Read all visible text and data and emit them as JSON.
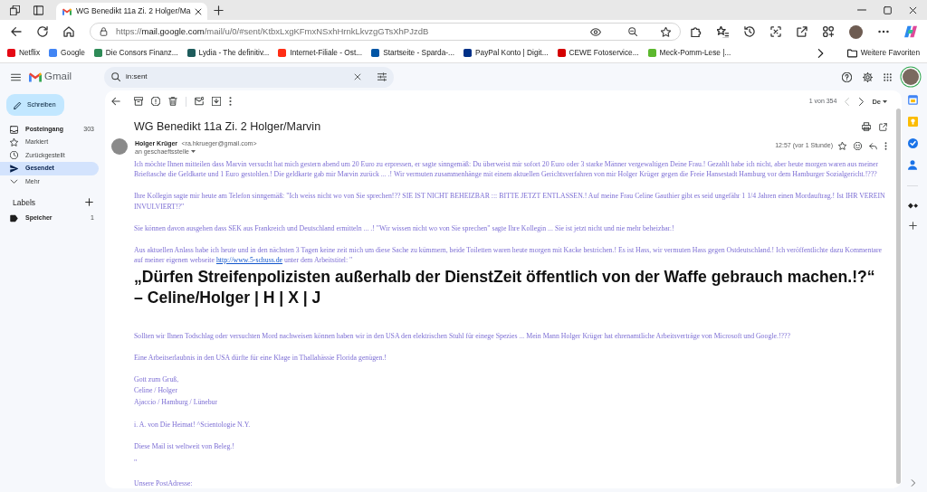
{
  "browser": {
    "tab": {
      "title": "WG Benedikt 11a Zi. 2 Holger/Ma"
    },
    "address_bar": {
      "scheme": "https://",
      "host": "mail.google.com",
      "path": "/mail/u/0/#sent/KtbxLxgKFmxNSxhHrnkLkvzgGTsXhPJzdB"
    },
    "favorites": [
      {
        "label": "Netflix",
        "color": "#e50914"
      },
      {
        "label": "Google",
        "color": "#4285f4"
      },
      {
        "label": "Die Consors Finanz...",
        "color": "#2e8b57"
      },
      {
        "label": "Lydia - The definitiv...",
        "color": "#1e5c5c"
      },
      {
        "label": "Internet-Filiale - Ost...",
        "color": "#ff2d14"
      },
      {
        "label": "Startseite - Sparda-...",
        "color": "#0055a5"
      },
      {
        "label": "PayPal Konto | Digit...",
        "color": "#003087"
      },
      {
        "label": "CEWE Fotoservice...",
        "color": "#d40000"
      },
      {
        "label": "Meck-Pomm-Lese |...",
        "color": "#5cb82e"
      }
    ],
    "more_favorites": "Weitere Favoriten"
  },
  "gmail": {
    "brand": "Gmail",
    "search": {
      "value": "in:sent"
    },
    "compose": "Schreiben",
    "folders": [
      {
        "kind": "inbox",
        "label": "Posteingang",
        "count": "303",
        "unread": true,
        "selected": false
      },
      {
        "kind": "star",
        "label": "Markiert",
        "unread": false,
        "selected": false
      },
      {
        "kind": "snooze",
        "label": "Zurückgestellt",
        "unread": false,
        "selected": false
      },
      {
        "kind": "sent",
        "label": "Gesendet",
        "unread": false,
        "selected": true
      },
      {
        "kind": "more",
        "label": "Mehr",
        "unread": false,
        "selected": false
      }
    ],
    "labels": {
      "title": "Labels",
      "items": [
        {
          "label": "Speicher",
          "count": "1",
          "unread": true
        }
      ]
    },
    "pager": {
      "text": "1 von 354",
      "previous_disabled": true
    },
    "input_tool": "De",
    "message": {
      "subject": "WG Benedikt 11a Zi. 2 Holger/Marvin",
      "sender": {
        "name": "Holger Krüger",
        "email": "<ra.hkrueger@gmail.com>"
      },
      "recipient": "an geschaeftsstelle",
      "time": "12:57 (vor 1 Stunde)",
      "body": [
        {
          "kind": "paragraph",
          "text": "Ich möchte Ihnen mitteilen dass Marvin versucht hat mich gestern abend um 20 Euro zu erpressen, er sagte sinngemäß: Du überweist mir sofort 20 Euro oder 3 starke Männer vergewaltigen Deine Frau.! Gezahlt habe ich nicht, aber heute morgen waren aus meiner Brieftasche die Geldkarte und 1 Euro gestohlen.! Die geldkarte gab mir Marvin zurück ... .! Wir vermuten zusammenhänge mit einem aktuellen Gerichtsverfahren von mir Holger Krüger gegen die Freie Hansestadt Hamburg vor dem Hamburger Sozialgericht.!???"
        },
        {
          "kind": "paragraph",
          "text": "Ihre Kollegin sagte mir heute am Telefon sinngemäß: \"Ich weiss nicht wo von Sie sprechen!?? SIE IST NICHT BEHEIZBAR ::: BITTE JETZT ENTLASSEN.! Auf meine Frau Celine Gauthier gibt es seid ungefähr 1 1/4 Jahren einen Mordauftrag.! Ist IHR VEREIN INVULVIERT!?\""
        },
        {
          "kind": "paragraph",
          "text": "Sie können davon ausgehen dass SEK aus Frankreich und Deutschland ermitteln ... .! \"Wir wissen nicht wo von Sie sprechen\" sagte Ihre Kollegin ... Sie ist jetzt nicht und nie mehr beheizbar.!"
        },
        {
          "kind": "paragraph",
          "parts": [
            {
              "kind": "text",
              "text": "Aus aktuellen Anlass habe ich heute und in den nächsten 3 Tagen keine zeit mich um diese Sache zu kümmern, beide Toiletten waren heute morgen mit Kacke bestrichen.! Es ist Hass, wir vermuten Hass gegen Ostdeutschland.! Ich veröffentlichte dazu Kommentare auf meiner eigenen webseite "
            },
            {
              "kind": "link",
              "text": "http://www.5-schuss.de"
            },
            {
              "kind": "text",
              "text": " unter dem Arbeitstitel: \""
            }
          ]
        },
        {
          "kind": "heading",
          "text": "„Dürfen Streifenpolizisten außerhalb der DienstZeit öffentlich von der Waffe gebrauch machen.!?“ – Celine/Holger | H | X | J"
        },
        {
          "kind": "paragraph",
          "text": "Sollten wir Ihnen Todschlag oder versuchten Mord nachweisen können haben wir in den USA den elektrischen Stuhl für einege Spezies ... Mein Mann Holger Krüger hat ehrenamtliche Arbeitsverträge von Microsoft und Google.!???"
        },
        {
          "kind": "paragraph",
          "text": "Eine Arbeitserlaubnis in den USA dürfte für eine Klage in Thallahässie Florida genügen.!"
        },
        {
          "kind": "lines",
          "lines": [
            "Gott zum Gruß,",
            "Celine / Holger",
            "Ajaccio / Hamburg / Lünebur"
          ]
        },
        {
          "kind": "paragraph",
          "text": "i. A. von Die Heimat! ^Scientologie N.Y."
        },
        {
          "kind": "paragraph",
          "text": "Diese Mail ist weltweit von Beleg.!"
        },
        {
          "kind": "paragraph",
          "text": "\""
        },
        {
          "kind": "paragraph",
          "text": "Unsere PostAdresse:"
        }
      ]
    }
  }
}
